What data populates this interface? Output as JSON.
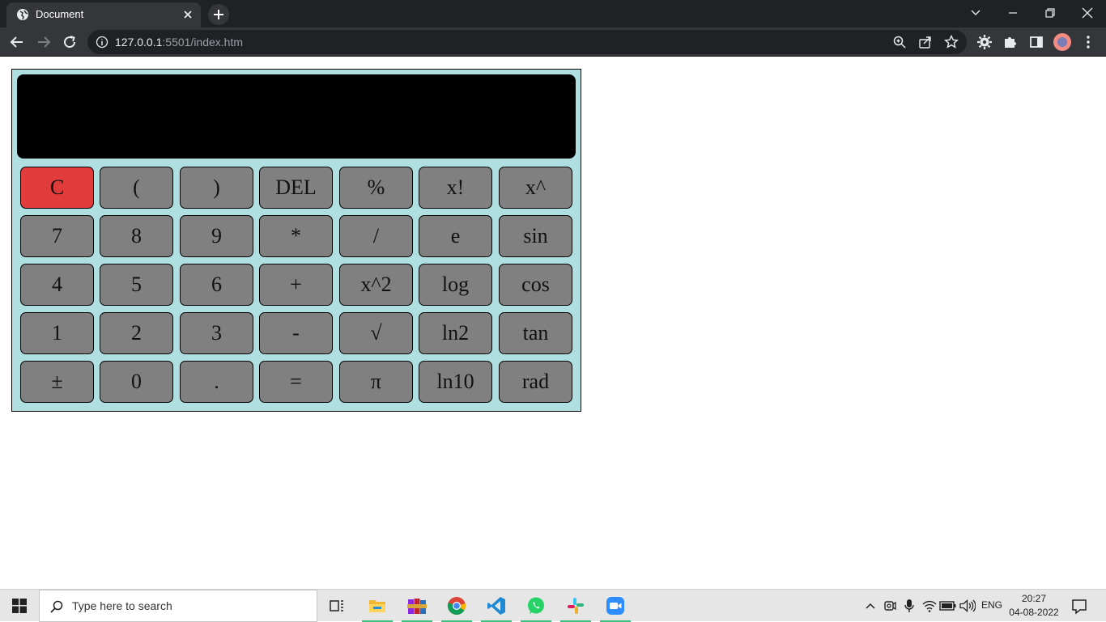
{
  "browser": {
    "tab_title": "Document",
    "url_host": "127.0.0.1",
    "url_rest": ":5501/index.htm"
  },
  "calculator": {
    "display_value": "",
    "keys": [
      [
        "C",
        "(",
        ")",
        "DEL",
        "%",
        "x!",
        "x^"
      ],
      [
        "7",
        "8",
        "9",
        "*",
        "/",
        "e",
        "sin"
      ],
      [
        "4",
        "5",
        "6",
        "+",
        "x^2",
        "log",
        "cos"
      ],
      [
        "1",
        "2",
        "3",
        "-",
        "√",
        "ln2",
        "tan"
      ],
      [
        "±",
        "0",
        ".",
        "=",
        "π",
        "ln10",
        "rad"
      ]
    ],
    "colors": {
      "body": "#b0dfe1",
      "key": "#808080",
      "clear_key": "#e03c3c",
      "display": "#000000"
    }
  },
  "taskbar": {
    "search_placeholder": "Type here to search",
    "language": "ENG",
    "time": "20:27",
    "date": "04-08-2022"
  }
}
